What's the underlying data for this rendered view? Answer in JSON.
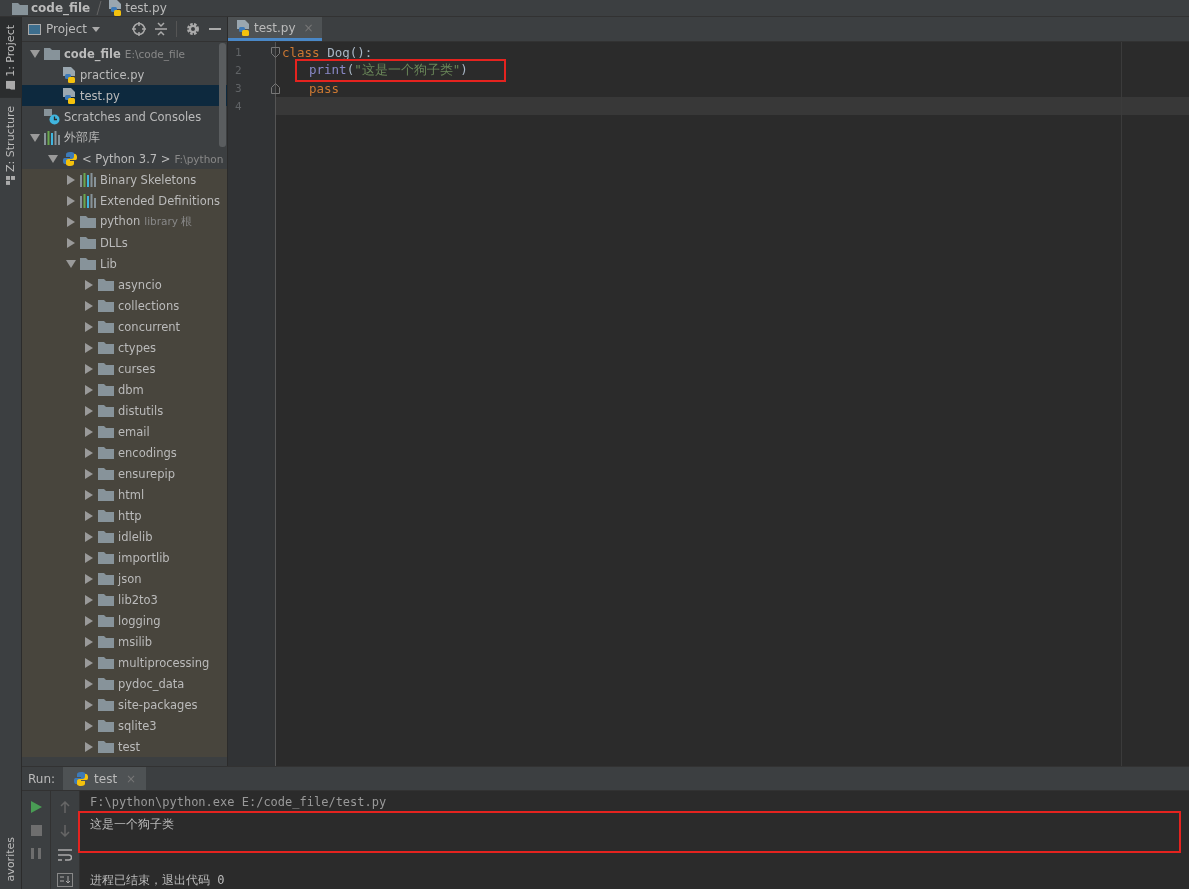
{
  "breadcrumbs": [
    {
      "label": "code_file",
      "kind": "folder"
    },
    {
      "label": "test.py",
      "kind": "python"
    }
  ],
  "tool_stripe": {
    "top": [
      {
        "label": "1: Project",
        "selected": true
      },
      {
        "label": "Z: Structure",
        "selected": false
      }
    ],
    "bottom": [
      {
        "label": "avorites",
        "selected": false
      }
    ]
  },
  "project_panel": {
    "title": "Project",
    "tree": [
      {
        "label": "code_file",
        "detail": "E:\\code_file",
        "kind": "project",
        "expanded": true,
        "selected": false,
        "children": [
          {
            "label": "practice.py",
            "kind": "python",
            "selected": false
          },
          {
            "label": "test.py",
            "kind": "python",
            "selected": true
          }
        ]
      },
      {
        "label": "Scratches and Consoles",
        "kind": "scratches",
        "selected": false
      },
      {
        "label": "外部库",
        "kind": "libraries",
        "expanded": true,
        "selected": false,
        "children": [
          {
            "label": "< Python 3.7 >",
            "detail": "F:\\python",
            "kind": "sdk",
            "expanded": true,
            "selected": false,
            "children": [
              {
                "label": "Binary Skeletons",
                "kind": "library",
                "expanded": false,
                "selected": false
              },
              {
                "label": "Extended Definitions",
                "kind": "library",
                "expanded": false,
                "selected": false
              },
              {
                "label": "python",
                "detail": "library 根",
                "kind": "folder",
                "expanded": false,
                "selected": false
              },
              {
                "label": "DLLs",
                "kind": "folder",
                "expanded": false,
                "selected": false
              },
              {
                "label": "Lib",
                "kind": "folder",
                "expanded": true,
                "selected": false,
                "children": [
                  {
                    "label": "asyncio",
                    "kind": "folder",
                    "expanded": false,
                    "selected": false
                  },
                  {
                    "label": "collections",
                    "kind": "folder",
                    "expanded": false,
                    "selected": false
                  },
                  {
                    "label": "concurrent",
                    "kind": "folder",
                    "expanded": false,
                    "selected": false
                  },
                  {
                    "label": "ctypes",
                    "kind": "folder",
                    "expanded": false,
                    "selected": false
                  },
                  {
                    "label": "curses",
                    "kind": "folder",
                    "expanded": false,
                    "selected": false
                  },
                  {
                    "label": "dbm",
                    "kind": "folder",
                    "expanded": false,
                    "selected": false
                  },
                  {
                    "label": "distutils",
                    "kind": "folder",
                    "expanded": false,
                    "selected": false
                  },
                  {
                    "label": "email",
                    "kind": "folder",
                    "expanded": false,
                    "selected": false
                  },
                  {
                    "label": "encodings",
                    "kind": "folder",
                    "expanded": false,
                    "selected": false
                  },
                  {
                    "label": "ensurepip",
                    "kind": "folder",
                    "expanded": false,
                    "selected": false
                  },
                  {
                    "label": "html",
                    "kind": "folder",
                    "expanded": false,
                    "selected": false
                  },
                  {
                    "label": "http",
                    "kind": "folder",
                    "expanded": false,
                    "selected": false
                  },
                  {
                    "label": "idlelib",
                    "kind": "folder",
                    "expanded": false,
                    "selected": false
                  },
                  {
                    "label": "importlib",
                    "kind": "folder",
                    "expanded": false,
                    "selected": false
                  },
                  {
                    "label": "json",
                    "kind": "folder",
                    "expanded": false,
                    "selected": false
                  },
                  {
                    "label": "lib2to3",
                    "kind": "folder",
                    "expanded": false,
                    "selected": false
                  },
                  {
                    "label": "logging",
                    "kind": "folder",
                    "expanded": false,
                    "selected": false
                  },
                  {
                    "label": "msilib",
                    "kind": "folder",
                    "expanded": false,
                    "selected": false
                  },
                  {
                    "label": "multiprocessing",
                    "kind": "folder",
                    "expanded": false,
                    "selected": false
                  },
                  {
                    "label": "pydoc_data",
                    "kind": "folder",
                    "expanded": false,
                    "selected": false
                  },
                  {
                    "label": "site-packages",
                    "kind": "folder",
                    "expanded": false,
                    "selected": false
                  },
                  {
                    "label": "sqlite3",
                    "kind": "folder",
                    "expanded": false,
                    "selected": false
                  },
                  {
                    "label": "test",
                    "kind": "folder",
                    "expanded": false,
                    "selected": false
                  }
                ]
              }
            ]
          }
        ]
      }
    ]
  },
  "editor": {
    "tabs": [
      {
        "label": "test.py",
        "close": "×",
        "selected": true
      }
    ],
    "lines": [
      {
        "number": "1",
        "kind": "head",
        "current": false,
        "annotated": false,
        "tokens": [
          {
            "text": "class",
            "kind": "keyword"
          },
          {
            "text": "Dog():",
            "kind": "plain"
          }
        ]
      },
      {
        "number": "2",
        "kind": "body",
        "current": false,
        "annotated": true,
        "tokens": [
          {
            "text": "print",
            "kind": "builtin"
          },
          {
            "text": "(",
            "kind": "plain"
          },
          {
            "text": "\"这是一个狗子类\"",
            "kind": "string"
          },
          {
            "text": ")",
            "kind": "plain"
          }
        ]
      },
      {
        "number": "3",
        "kind": "tail",
        "current": false,
        "annotated": false,
        "tokens": [
          {
            "text": "pass",
            "kind": "keyword"
          }
        ]
      },
      {
        "number": "4",
        "kind": "blank",
        "current": true,
        "annotated": false
      }
    ]
  },
  "run_panel": {
    "title": "Run:",
    "tabs": [
      {
        "label": "test",
        "close": "×",
        "selected": true
      }
    ],
    "output": [
      {
        "text": "F:\\python\\python.exe E:/code_file/test.py",
        "kind": "command",
        "annotated": false
      },
      {
        "text": "这是一个狗子类",
        "kind": "stdout",
        "annotated": true
      },
      {
        "kind": "blank"
      },
      {
        "text": "进程已结束，退出代码 0",
        "kind": "stdout",
        "annotated": false
      }
    ]
  }
}
